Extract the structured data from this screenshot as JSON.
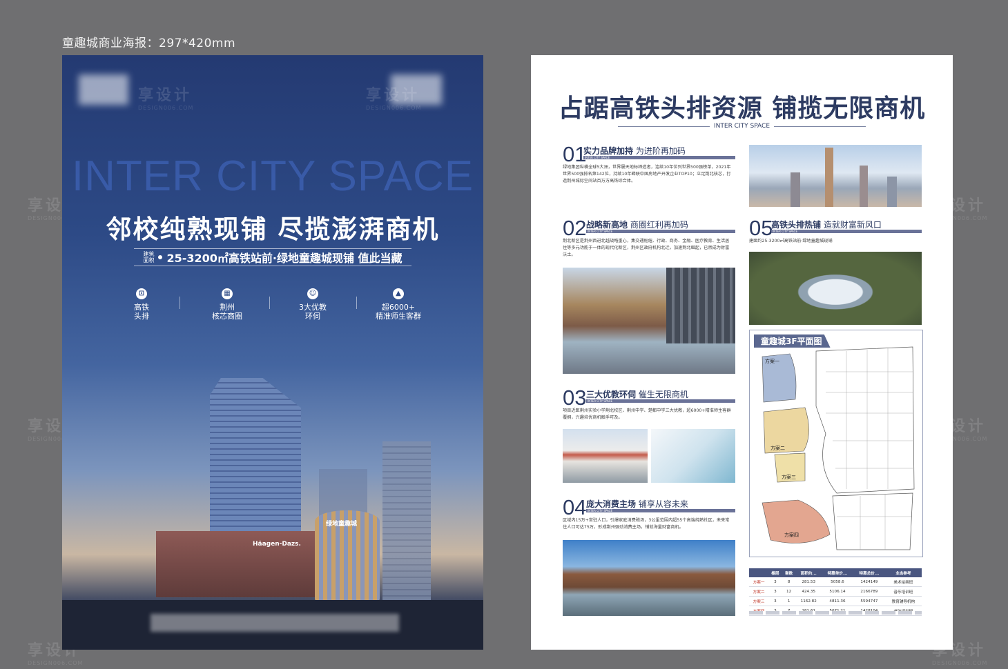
{
  "caption": "童趣城商业海报：297*420mm",
  "watermark": {
    "cn": "享设计",
    "en": "DESIGN006.COM"
  },
  "left": {
    "english": "INTER CITY SPACE",
    "headline": "邻校纯熟现铺 尽揽澎湃商机",
    "area_tag": "建筑面积",
    "subline": "25-3200㎡高铁站前·绿地童趣城现铺 值此当藏",
    "features": [
      {
        "icon": "train-icon",
        "glyph": "⊡",
        "line1": "高铁",
        "line2": "头排"
      },
      {
        "icon": "building-icon",
        "glyph": "▦",
        "line1": "荆州",
        "line2": "核芯商圈"
      },
      {
        "icon": "education-icon",
        "glyph": "☺",
        "line1": "3大优教",
        "line2": "环伺"
      },
      {
        "icon": "graduation-cap-icon",
        "glyph": "▲",
        "line1": "超6000+",
        "line2": "精准师生客群"
      }
    ],
    "signs": {
      "haagen": "Häagen-Dazs.",
      "mall": "绿地童趣城"
    }
  },
  "right": {
    "title": "占踞高铁头排资源 铺揽无限商机",
    "subtitle": "INTER CITY SPACE",
    "bar_label": "INTER CITY SPACE",
    "sections": [
      {
        "num": "01",
        "head_bold": "实力品牌加持",
        "head_rest": " 为进阶再加码",
        "lines": [
          "绿地集团纵横全球5大洲，世界屡天地标缔造者，连续10年位列世界500强榜单，2021年",
          "世界500强排名第142位，持续10年蝉联中国房地产开发企业TOP10；立足荆北核芯，打",
          "造荆州城际空间站百万方高铁综合体。"
        ]
      },
      {
        "num": "02",
        "head_bold": "战略新高地",
        "head_rest": " 商圈红利再加码",
        "lines": [
          "荆北新区是荆州西进北越战略重心，集交通枢纽、行政、商务、金融、医疗教育、生活居",
          "住等多元功能于一体的现代化新区，荆州区政府机构北迁，加速荆北崛起，已然成为财富",
          "沃土。"
        ]
      },
      {
        "num": "03",
        "head_bold": "三大优教环伺",
        "head_rest": " 催生无限商机",
        "lines": [
          "项目近距荆州实验小学荆北校区、荆州中学、楚都中学三大优教，超6000+精准师生客群",
          "覆拥，兴趣培优商机触手可及。"
        ]
      },
      {
        "num": "04",
        "head_bold": "庞大消费主场",
        "head_rest": " 铺享从容未来",
        "lines": [
          "区域内15万+常驻人口，引爆家庭消费磁场，3公里范围内超55个高端纯熟社区，未来常",
          "住人口可达75万，形成荆州强劲消费主场，铺就海量财富商机。"
        ]
      },
      {
        "num": "05",
        "head_bold": "高铁头排热铺",
        "head_rest": " 造就财富新风口",
        "lines": [
          "建面约25-3200㎡高铁站前·绿地童趣城现铺"
        ]
      }
    ],
    "plan_title": "童趣城3F平面图",
    "plan_labels": [
      "方案一",
      "方案二",
      "方案三",
      "方案四"
    ],
    "table": {
      "headers": [
        "",
        "楼层",
        "套数",
        "面积约...",
        "特惠单价...",
        "特惠总价...",
        "业态参考"
      ],
      "rows": [
        [
          "方案一",
          "3",
          "8",
          "281.53",
          "5058.6",
          "1424149",
          "美术绘画班"
        ],
        [
          "方案二",
          "3",
          "12",
          "424.35",
          "5106.14",
          "2166789",
          "音乐培训班"
        ],
        [
          "方案三",
          "3",
          "1",
          "1162.82",
          "4811.36",
          "5594747",
          "教育辅导机构"
        ],
        [
          "方案四",
          "3",
          "7",
          "281.61",
          "5071.21",
          "1428104",
          "书法培训班"
        ]
      ]
    }
  },
  "colors": {
    "navy": "#2d3b62",
    "bar": "#6a7298",
    "poster_blue": "#2d4a86"
  }
}
